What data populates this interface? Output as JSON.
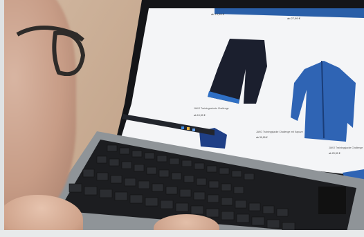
{
  "scene": {
    "description_colors": {
      "screen_background": "#f4f5f7",
      "product_navy": "#1b2c57",
      "product_blue": "#2f64b4",
      "keyboard": "#1c1d20",
      "laptop_body": "#8f9498"
    }
  },
  "shop": {
    "price_top_left": "ab 19,99 €",
    "price_top_right": "ab 27,99 €",
    "product1_label": "JAKO Trainingsshorts Challenge",
    "product1_price": "ab 19,99 €",
    "product2_label": "JAKO Trainingsjacke Challenge mit Kapuze",
    "product2_price": "ab 39,99 €",
    "product3_label": "JAKO Trainingsjacke Challenge",
    "product3_price": "ab 29,99 €"
  }
}
